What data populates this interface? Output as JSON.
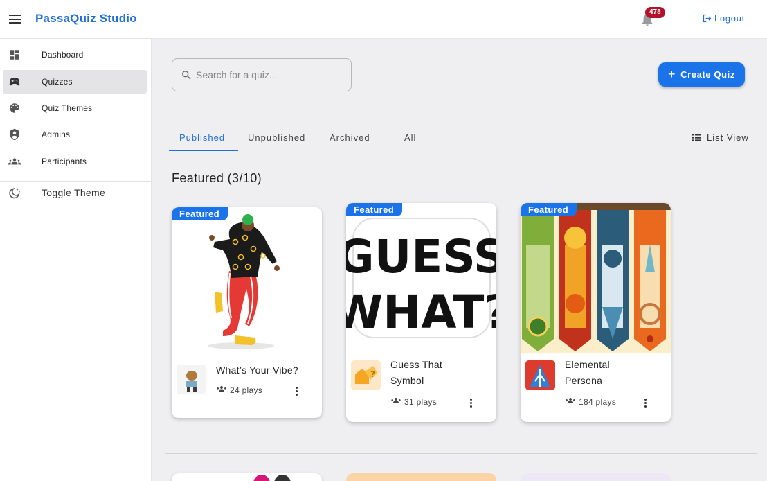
{
  "app": {
    "title": "PassaQuiz Studio"
  },
  "header": {
    "notification_count": "478",
    "logout_label": "Logout"
  },
  "sidebar": {
    "items": [
      {
        "label": "Dashboard",
        "icon": "dashboard-icon"
      },
      {
        "label": "Quizzes",
        "icon": "gamepad-icon",
        "active": true
      },
      {
        "label": "Quiz Themes",
        "icon": "palette-icon"
      },
      {
        "label": "Admins",
        "icon": "shield-person-icon"
      },
      {
        "label": "Participants",
        "icon": "people-icon"
      }
    ],
    "toggle_theme_label": "Toggle Theme"
  },
  "search": {
    "placeholder": "Search for a quiz...",
    "value": ""
  },
  "create_button_label": "Create Quiz",
  "tabs": [
    {
      "label": "Published",
      "active": true
    },
    {
      "label": "Unpublished"
    },
    {
      "label": "Archived"
    },
    {
      "label": "All"
    }
  ],
  "list_view_label": "List View",
  "featured": {
    "title": "Featured (3/10)",
    "badge_label": "Featured",
    "cards": [
      {
        "name": "What’s Your Vibe?",
        "plays": "24 plays"
      },
      {
        "name_line1": "Guess That",
        "name_line2": "Symbol",
        "plays": "31 plays",
        "image_line1": "GUESS",
        "image_line2": "WHAT?"
      },
      {
        "name_line1": "Elemental",
        "name_line2": "Persona",
        "plays": "184 plays"
      }
    ]
  },
  "colors": {
    "accent": "#1a73e8",
    "brand": "#1f6ed9",
    "badge": "#b3132a"
  }
}
